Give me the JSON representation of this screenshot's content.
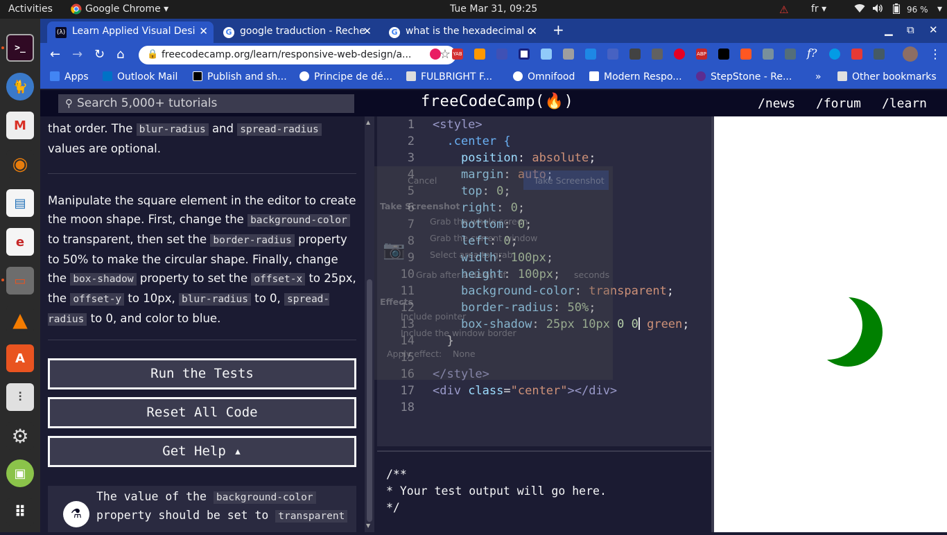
{
  "system_bar": {
    "activities": "Activities",
    "app_menu": "Google Chrome",
    "clock": "Tue Mar 31, 09:25",
    "language": "fr",
    "battery": "96 %"
  },
  "browser": {
    "tabs": [
      {
        "title": "Learn Applied Visual Desi",
        "favicon_color": "#ffffff"
      },
      {
        "title": "google traduction - Reche",
        "favicon_color": "#4285f4"
      },
      {
        "title": "what is the hexadecimal c",
        "favicon_color": "#4285f4"
      }
    ],
    "new_tab_label": "+",
    "url": "freecodecamp.org/learn/responsive-web-design/a...",
    "bookmarks": [
      {
        "label": "Apps",
        "color": "#4285f4"
      },
      {
        "label": "Outlook Mail",
        "color": "#0072c6"
      },
      {
        "label": "Publish and sh...",
        "color": "#000000"
      },
      {
        "label": "Principe de dé...",
        "color": "#ffffff"
      },
      {
        "label": "FULBRIGHT F...",
        "color": "#ffffff"
      },
      {
        "label": "Omnifood",
        "color": "#ffffff"
      },
      {
        "label": "Modern Respo...",
        "color": "#ffffff"
      },
      {
        "label": "StepStone - Re...",
        "color": "#5c2d91"
      }
    ],
    "more_bookmarks": "»",
    "other_bookmarks": "Other bookmarks"
  },
  "fcc": {
    "search_placeholder": "Search 5,000+ tutorials",
    "logo": "freeCodeCamp(🔥)",
    "nav": [
      "/news",
      "/forum",
      "/learn"
    ]
  },
  "instructions": {
    "p1_a": "that order. The ",
    "p1_code1": "blur-radius",
    "p1_b": " and ",
    "p1_code2": "spread-radius",
    "p1_c": " values are optional.",
    "p2_a": "Manipulate the square element in the editor to create the moon shape. First, change the ",
    "p2_code1": "background-color",
    "p2_b": " to transparent, then set the ",
    "p2_code2": "border-radius",
    "p2_c": " property to 50% to make the circular shape. Finally, change the ",
    "p2_code3": "box-shadow",
    "p2_d": " property to set the ",
    "p2_code4": "offset-x",
    "p2_e": " to 25px, the ",
    "p2_code5": "offset-y",
    "p2_f": " to 10px, ",
    "p2_code6": "blur-radius",
    "p2_g": " to 0, ",
    "p2_code7": "spread-radius",
    "p2_h": " to 0, and color to blue."
  },
  "buttons": {
    "run": "Run the Tests",
    "reset": "Reset All Code",
    "help": "Get Help ▴"
  },
  "test": {
    "text_a": "The value of the ",
    "code": "background-color",
    "text_b": " property should be set to ",
    "code2": "transparent"
  },
  "editor": {
    "line_numbers": [
      "1",
      "2",
      "3",
      "4",
      "5",
      "6",
      "7",
      "8",
      "9",
      "10",
      "11",
      "12",
      "13",
      "14",
      "15",
      "16",
      "17",
      "18"
    ],
    "l1": "<style>",
    "l2": ".center {",
    "l3_p": "position",
    "l3_v": "absolute",
    "l4_p": "margin",
    "l4_v": "auto",
    "l5_p": "top",
    "l5_v": "0",
    "l6_p": "right",
    "l6_v": "0",
    "l7_p": "bottom",
    "l7_v": "0",
    "l8_p": "left",
    "l8_v": "0",
    "l9_p": "width",
    "l9_v": "100px",
    "l10_p": "height",
    "l10_v": "100px",
    "l11_p": "background-color",
    "l11_v": "transparent",
    "l12_p": "border-radius",
    "l12_v": "50%",
    "l13_p": "box-shadow",
    "l13_v1": "25px 10px 0 0",
    "l13_v2": " green",
    "l14": "}",
    "l16": "</style>",
    "l17_open": "<div ",
    "l17_attr": "class",
    "l17_val": "\"center\"",
    "l17_close": "></div>"
  },
  "screenshot_dialog": {
    "cancel": "Cancel",
    "take": "Take Screenshot",
    "title": "Take Screenshot",
    "opt1": "Grab the whole screen",
    "opt2": "Grab the current window",
    "opt3": "Select area to grab",
    "delay_a": "Grab after a delay of",
    "delay_b": "seconds",
    "effects": "Effects",
    "pointer": "Include pointer",
    "border": "Include the window border",
    "apply": "Apply effect:",
    "none": "None"
  },
  "output": {
    "l1": "/**",
    "l2": "* Your test output will go here.",
    "l3": "*/"
  },
  "preview": {
    "moon_color": "#008000"
  }
}
